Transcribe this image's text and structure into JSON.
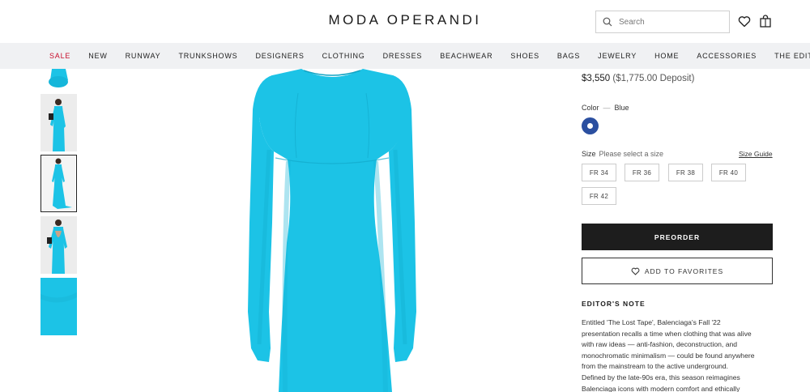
{
  "header": {
    "logo": "MODA OPERANDI",
    "search_placeholder": "Search",
    "icons": [
      "search-icon",
      "heart-icon",
      "shopping-bag-icon"
    ]
  },
  "nav": {
    "items": [
      {
        "label": "SALE",
        "color": "#c8102e"
      },
      {
        "label": "NEW"
      },
      {
        "label": "RUNWAY"
      },
      {
        "label": "TRUNKSHOWS"
      },
      {
        "label": "DESIGNERS"
      },
      {
        "label": "CLOTHING"
      },
      {
        "label": "DRESSES"
      },
      {
        "label": "BEACHWEAR"
      },
      {
        "label": "SHOES"
      },
      {
        "label": "BAGS"
      },
      {
        "label": "JEWELRY"
      },
      {
        "label": "HOME"
      },
      {
        "label": "ACCESSORIES"
      },
      {
        "label": "THE EDIT"
      }
    ]
  },
  "gallery": {
    "product_color": "#1cc3e6",
    "selected_index": 2,
    "thumbnail_count": 5
  },
  "product": {
    "price": "$3,550",
    "deposit": "($1,775.00 Deposit)",
    "color_label": "Color",
    "color_value": "Blue",
    "swatch_color": "#2b4fa0",
    "size_label": "Size",
    "size_hint": "Please select a size",
    "size_guide": "Size Guide",
    "sizes": [
      "FR 34",
      "FR 36",
      "FR 38",
      "FR 40",
      "FR 42"
    ],
    "preorder_label": "PREORDER",
    "favorites_label": "ADD TO FAVORITES"
  },
  "editors_note": {
    "title": "EDITOR'S NOTE",
    "lines": [
      "Entitled 'The Lost Tape', Balenciaga's Fall '22",
      "presentation recalls a time when clothing that was alive",
      "with raw ideas — anti-fashion, deconstruction, and",
      "monochromatic minimalism — could be found anywhere",
      "from the mainstream to the active underground.",
      "Defined by the late-90s era, this season reimagines",
      "Balenciaga icons with modern comfort and ethically"
    ]
  }
}
